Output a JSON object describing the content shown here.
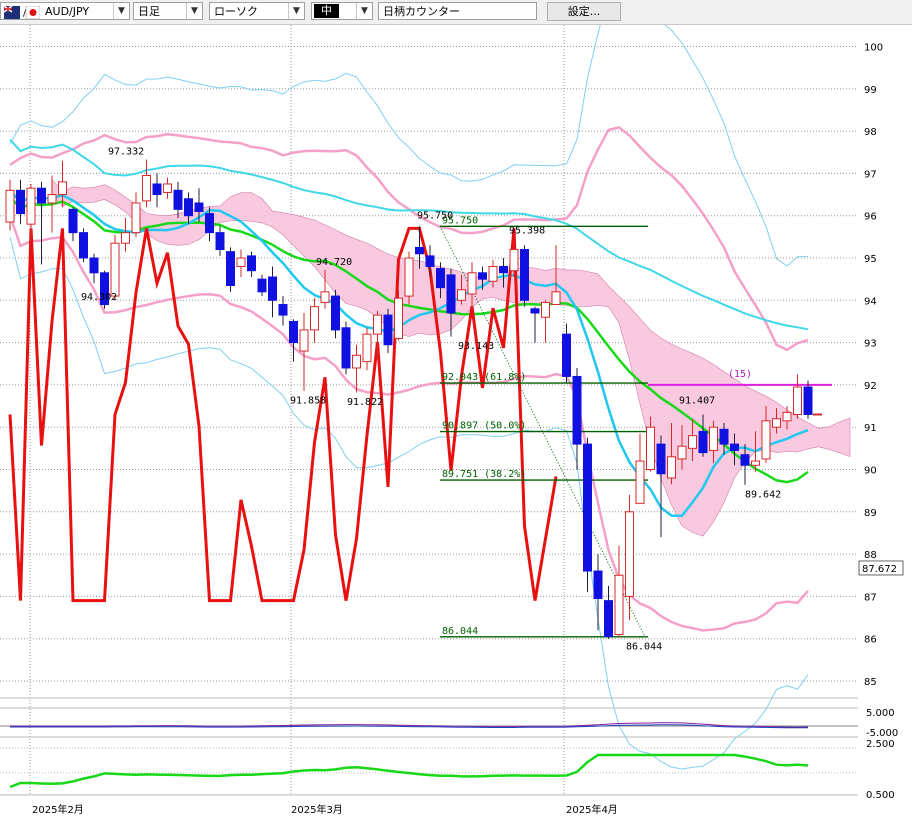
{
  "toolbar": {
    "symbol": "AUD/JPY",
    "period": "日足",
    "chart_type": "ローソク",
    "size": "中",
    "counter": "日柄カウンター",
    "settings": "設定..."
  },
  "chart_data": {
    "type": "candlestick",
    "y_range": [
      84.5,
      100.3
    ],
    "y_ticks": [
      "100",
      "99",
      "98",
      "97",
      "96",
      "95",
      "94",
      "93",
      "92",
      "91",
      "90",
      "89",
      "88",
      "87",
      "86",
      "85"
    ],
    "last_price": "87.672",
    "x_labels": [
      "2025年2月",
      "2025年3月",
      "2025年4月"
    ],
    "candles": [
      [
        95.85,
        96.6,
        96.85,
        95.65
      ],
      [
        96.6,
        96.05,
        96.85,
        95.8
      ],
      [
        95.8,
        96.65,
        96.75,
        95.4
      ],
      [
        96.65,
        96.3,
        96.8,
        94.85
      ],
      [
        96.3,
        96.5,
        96.95,
        95.6
      ],
      [
        96.5,
        96.8,
        97.3,
        96.2
      ],
      [
        96.15,
        95.6,
        96.2,
        95.4
      ],
      [
        95.6,
        95.0,
        95.7,
        94.9
      ],
      [
        95.0,
        94.65,
        95.1,
        94.4
      ],
      [
        94.65,
        93.9,
        94.7,
        93.8
      ],
      [
        94.1,
        95.35,
        95.55,
        94.0
      ],
      [
        95.35,
        95.6,
        95.95,
        95.15
      ],
      [
        95.6,
        96.3,
        96.55,
        95.5
      ],
      [
        96.35,
        96.95,
        97.33,
        96.2
      ],
      [
        96.75,
        96.5,
        97.0,
        96.2
      ],
      [
        96.55,
        96.75,
        96.9,
        96.4
      ],
      [
        96.6,
        96.15,
        96.8,
        95.95
      ],
      [
        96.4,
        96.0,
        96.55,
        95.8
      ],
      [
        96.3,
        96.1,
        96.65,
        95.85
      ],
      [
        96.05,
        95.6,
        96.2,
        95.4
      ],
      [
        95.6,
        95.2,
        95.75,
        95.05
      ],
      [
        95.15,
        94.35,
        95.25,
        94.2
      ],
      [
        94.8,
        95.0,
        95.2,
        94.55
      ],
      [
        95.05,
        94.7,
        95.15,
        94.55
      ],
      [
        94.5,
        94.2,
        94.6,
        94.1
      ],
      [
        94.55,
        94.0,
        94.8,
        93.6
      ],
      [
        93.9,
        93.65,
        94.1,
        93.4
      ],
      [
        93.5,
        93.0,
        93.55,
        92.55
      ],
      [
        92.8,
        93.3,
        93.7,
        91.86
      ],
      [
        93.3,
        93.85,
        94.05,
        93.0
      ],
      [
        93.95,
        94.2,
        94.72,
        93.8
      ],
      [
        94.1,
        93.3,
        94.25,
        93.1
      ],
      [
        93.35,
        92.4,
        93.5,
        92.25
      ],
      [
        92.4,
        92.7,
        92.95,
        91.82
      ],
      [
        92.55,
        93.2,
        93.35,
        92.35
      ],
      [
        93.2,
        93.65,
        93.75,
        92.6
      ],
      [
        93.65,
        92.95,
        93.8,
        92.75
      ],
      [
        93.1,
        94.05,
        94.25,
        93.05
      ],
      [
        94.1,
        95.0,
        95.15,
        93.9
      ],
      [
        95.25,
        95.1,
        95.75,
        94.75
      ],
      [
        95.05,
        94.8,
        95.3,
        94.55
      ],
      [
        94.75,
        94.3,
        94.9,
        94.05
      ],
      [
        94.6,
        93.7,
        94.75,
        93.14
      ],
      [
        94.0,
        94.25,
        94.6,
        93.9
      ],
      [
        94.15,
        94.65,
        94.9,
        93.8
      ],
      [
        94.65,
        94.5,
        94.8,
        94.25
      ],
      [
        94.45,
        94.8,
        94.95,
        94.3
      ],
      [
        94.8,
        94.65,
        95.0,
        94.3
      ],
      [
        94.7,
        95.2,
        95.4,
        94.55
      ],
      [
        95.2,
        94.0,
        95.3,
        93.85
      ],
      [
        93.8,
        93.7,
        93.85,
        93.0
      ],
      [
        93.6,
        93.95,
        94.0,
        93.0
      ],
      [
        93.9,
        94.2,
        95.3,
        93.9
      ],
      [
        93.2,
        92.2,
        93.45,
        92.05
      ],
      [
        92.2,
        90.6,
        92.4,
        90.0
      ],
      [
        90.6,
        87.6,
        90.75,
        87.1
      ],
      [
        87.6,
        86.95,
        88.0,
        86.2
      ],
      [
        86.9,
        86.05,
        87.25,
        86.0
      ],
      [
        86.1,
        87.5,
        88.2,
        86.04
      ],
      [
        87.0,
        89.0,
        89.4,
        86.44
      ],
      [
        89.2,
        90.2,
        90.85,
        89.2
      ],
      [
        90.0,
        91.0,
        91.25,
        89.95
      ],
      [
        90.6,
        89.9,
        90.8,
        88.4
      ],
      [
        89.8,
        90.3,
        91.1,
        89.65
      ],
      [
        90.25,
        90.55,
        91.05,
        90.0
      ],
      [
        90.5,
        90.8,
        91.2,
        90.2
      ],
      [
        90.9,
        90.4,
        91.3,
        90.3
      ],
      [
        90.45,
        91.0,
        91.15,
        90.15
      ],
      [
        90.95,
        90.6,
        91.1,
        90.35
      ],
      [
        90.6,
        90.45,
        90.85,
        90.1
      ],
      [
        90.35,
        90.1,
        90.6,
        89.64
      ],
      [
        90.1,
        90.2,
        90.9,
        89.95
      ],
      [
        90.25,
        91.15,
        91.5,
        90.15
      ],
      [
        91.0,
        91.2,
        91.45,
        90.85
      ],
      [
        91.15,
        91.35,
        91.5,
        90.95
      ],
      [
        91.3,
        91.95,
        92.25,
        91.2
      ],
      [
        91.95,
        91.3,
        92.1,
        91.2
      ]
    ],
    "annotations": {
      "high_labels": [
        "97.332",
        "95.750",
        "95.398",
        "94.720",
        "91.407"
      ],
      "low_labels": [
        "94.302",
        "93.143",
        "91.858",
        "91.822",
        "86.044",
        "89.642"
      ],
      "fib_levels": [
        "95.750",
        "92.043 (61.8%)",
        "90.897 (50.0%)",
        "89.751 (38.2%)",
        "86.044"
      ],
      "counter": "(15)"
    },
    "oscillator_axis": [
      "5.000",
      "-5.000",
      "2.500",
      "0.500"
    ]
  },
  "colors": {
    "up": "#d42a2a",
    "down": "#1010e0",
    "ma_short": "#18d818",
    "ma_mid": "#20c8f0",
    "ma_long": "#40d8e8",
    "bollinger_inner": "#f5a0c8",
    "bollinger_outer": "#80d0f0",
    "ichimoku_cloud": "#f8c4dc",
    "rci_line": "#e81010",
    "fib": "#006000",
    "counter": "#e020e0"
  }
}
